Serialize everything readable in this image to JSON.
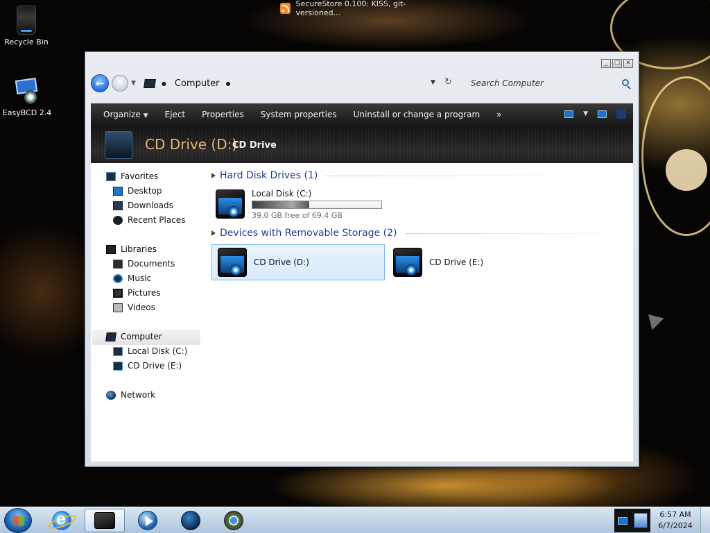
{
  "notification": {
    "text": "SecureStore 0.100: KISS, git-versioned..."
  },
  "desktop": {
    "icons": [
      {
        "label": "Recycle Bin"
      },
      {
        "label": "EasyBCD 2.4"
      }
    ]
  },
  "window": {
    "address": {
      "location": "Computer"
    },
    "search": {
      "placeholder": "Search Computer"
    },
    "toolbar": {
      "organize": "Organize",
      "eject": "Eject",
      "properties": "Properties",
      "system_properties": "System properties",
      "uninstall": "Uninstall or change a program",
      "more": "»"
    },
    "header": {
      "title": "CD Drive (D:)",
      "subtitle": "CD Drive"
    },
    "nav": {
      "favorites": "Favorites",
      "desktop": "Desktop",
      "downloads": "Downloads",
      "recent_places": "Recent Places",
      "libraries": "Libraries",
      "documents": "Documents",
      "music": "Music",
      "pictures": "Pictures",
      "videos": "Videos",
      "computer": "Computer",
      "local_disk_c": "Local Disk (C:)",
      "cd_drive_e": "CD Drive (E:)",
      "network": "Network"
    },
    "groups": {
      "hard_disks": {
        "title": "Hard Disk Drives (1)",
        "drives": [
          {
            "name": "Local Disk (C:)",
            "free_text": "39.0 GB free of 69.4 GB",
            "used_fraction": 0.44
          }
        ]
      },
      "removable": {
        "title": "Devices with Removable Storage (2)",
        "drives": [
          {
            "name": "CD Drive (D:)"
          },
          {
            "name": "CD Drive (E:)"
          }
        ]
      }
    }
  },
  "taskbar": {
    "clock_time": "6:57 AM",
    "clock_date": "6/7/2024"
  }
}
